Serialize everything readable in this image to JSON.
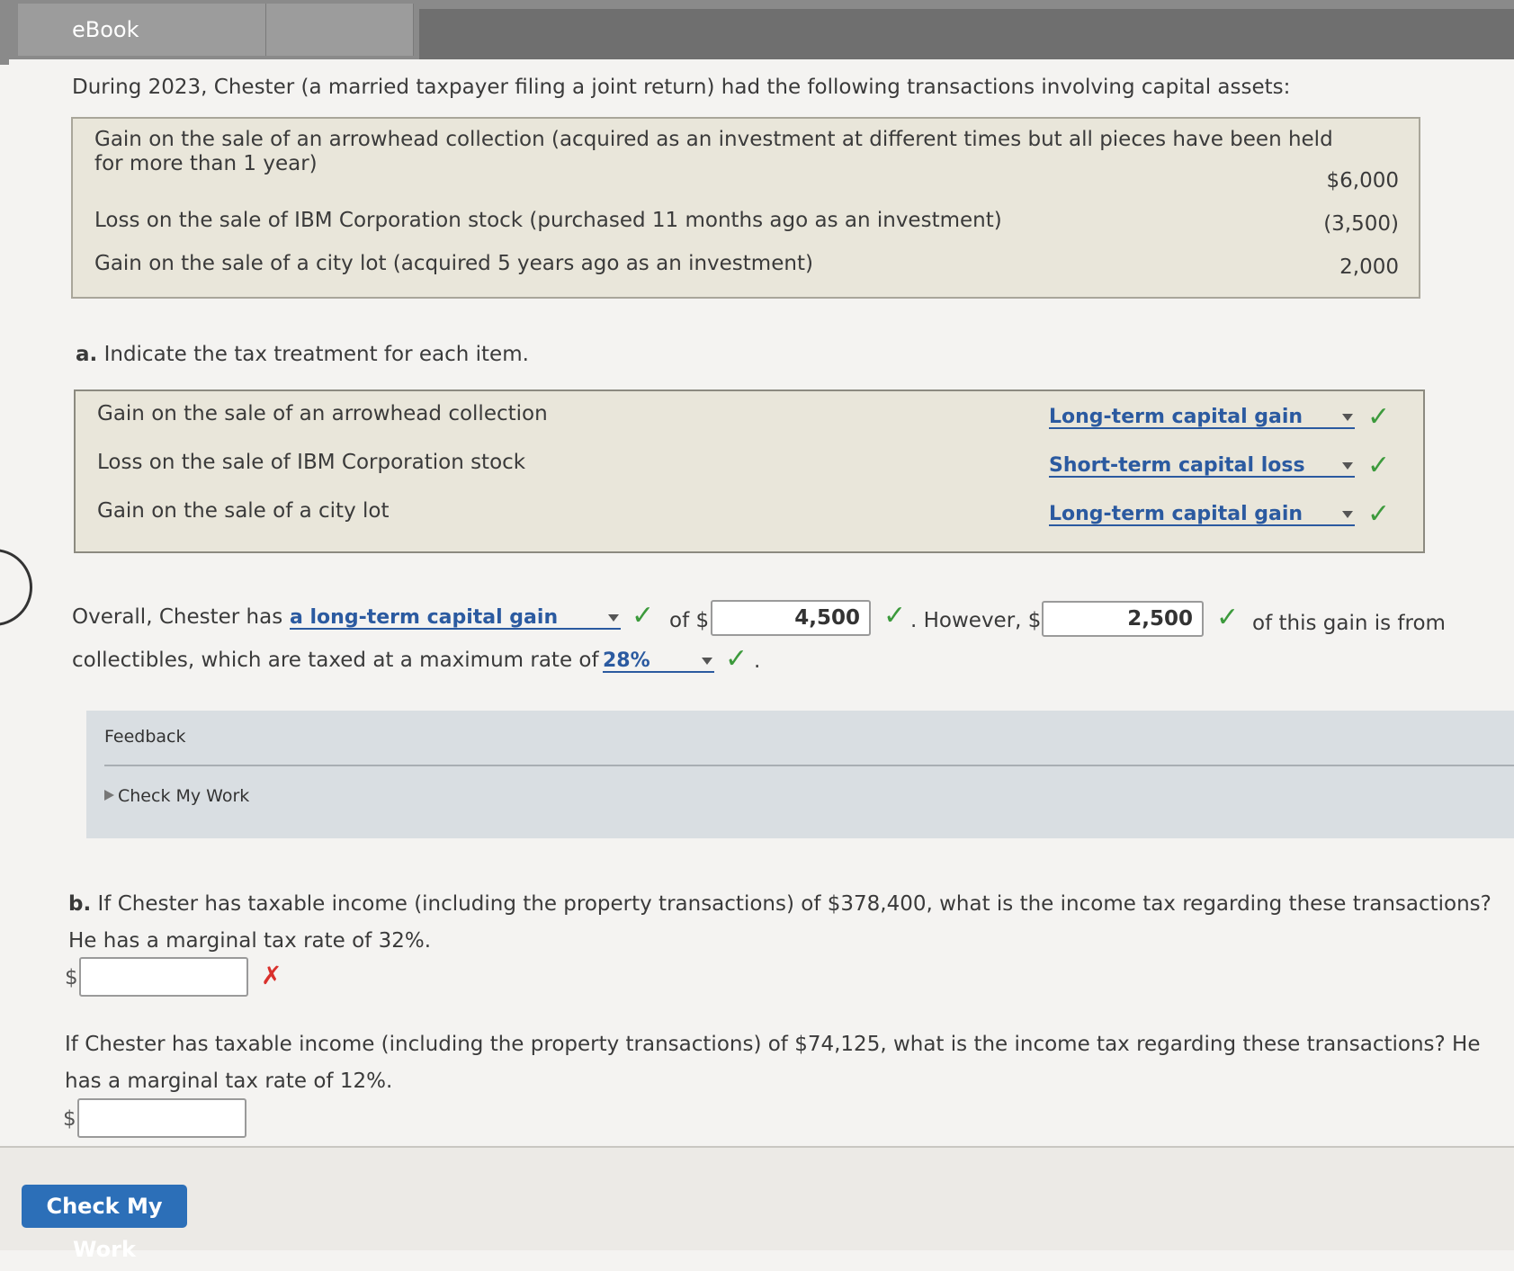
{
  "tabs": [
    {
      "label": "eBook"
    },
    {
      "label": ""
    }
  ],
  "intro": "During 2023, Chester (a married taxpayer filing a joint return) had the following transactions involving capital assets:",
  "transactions": [
    {
      "line1": "Gain on the sale of an arrowhead collection (acquired as an investment at different times but all pieces have been held",
      "line2": "for more than 1 year)",
      "value": "$6,000"
    },
    {
      "line1": "Loss on the sale of IBM Corporation stock (purchased 11 months ago as an investment)",
      "line2": "",
      "value": "(3,500)"
    },
    {
      "line1": "Gain on the sale of a city lot (acquired 5 years ago as an investment)",
      "line2": "",
      "value": "2,000"
    }
  ],
  "part_a": {
    "marker": "a.",
    "prompt": "Indicate the tax treatment for each item.",
    "items": [
      {
        "label": "Gain on the sale of an arrowhead collection",
        "selected": "Long-term capital gain"
      },
      {
        "label": "Loss on the sale of IBM Corporation stock",
        "selected": "Short-term capital loss"
      },
      {
        "label": "Gain on the sale of a city lot",
        "selected": "Long-term capital gain"
      }
    ],
    "overall": {
      "prefix": "Overall, Chester has",
      "selected": "a long-term capital gain",
      "of": "of $",
      "amount": "4,500",
      "however": ". However, $",
      "collectibles_amount": "2,500",
      "suffix": "of this gain is from",
      "line2": "collectibles, which are taxed at a maximum rate of",
      "rate": "28%",
      "period": "."
    }
  },
  "feedback": {
    "title": "Feedback",
    "check_label": "Check My Work"
  },
  "part_b": {
    "marker": "b.",
    "prompt": "If Chester has taxable income (including the property transactions) of $378,400, what is the income tax regarding these transactions? He has a marginal tax rate of 32%.",
    "currency": "$",
    "answer": "",
    "status": "✗"
  },
  "part_c": {
    "prompt": "If Chester has taxable income (including the property transactions) of $74,125, what is the income tax regarding these transactions? He has a marginal tax rate of 12%.",
    "currency": "$",
    "answer": ""
  },
  "check_mark": "✓",
  "buttons": {
    "check_my_work": "Check My Work"
  },
  "colors": {
    "accent": "#2b5aa0",
    "correct": "#3c9a3c",
    "incorrect": "#d9302c",
    "button": "#2c6fb8"
  }
}
